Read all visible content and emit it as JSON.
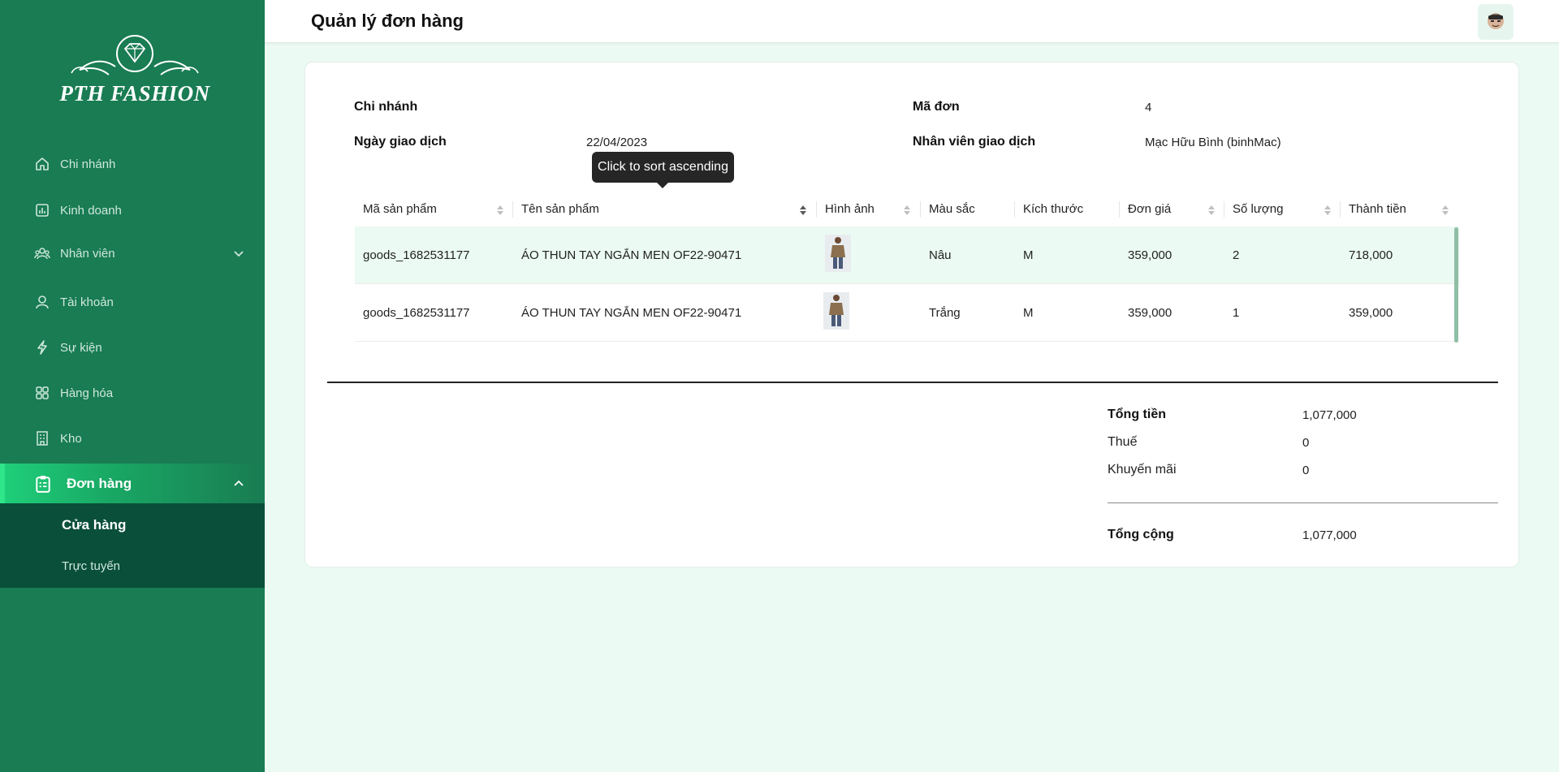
{
  "app": {
    "brand": "PTH FASHION"
  },
  "header": {
    "title": "Quản lý đơn hàng"
  },
  "sidebar": {
    "items": [
      {
        "label": "Chi nhánh",
        "icon": "home-icon"
      },
      {
        "label": "Kinh doanh",
        "icon": "chart-icon"
      },
      {
        "label": "Nhân viên",
        "icon": "users-icon"
      },
      {
        "label": "Tài khoản",
        "icon": "user-icon"
      },
      {
        "label": "Sự kiện",
        "icon": "bolt-icon"
      },
      {
        "label": "Hàng hóa",
        "icon": "grid-icon"
      },
      {
        "label": "Kho",
        "icon": "building-icon"
      },
      {
        "label": "Đơn hàng",
        "icon": "clipboard-icon"
      }
    ],
    "submenu": [
      {
        "label": "Cửa hàng"
      },
      {
        "label": "Trực tuyến"
      }
    ]
  },
  "order": {
    "branch_label": "Chi nhánh",
    "branch_value": "",
    "date_label": "Ngày giao dịch",
    "date_value": "22/04/2023",
    "code_label": "Mã đơn",
    "code_value": "4",
    "staff_label": "Nhân viên giao dịch",
    "staff_value": "Mạc Hữu Bình (binhMac)"
  },
  "table": {
    "columns": [
      "Mã sản phẩm",
      "Tên sản phẩm",
      "Hình ảnh",
      "Màu sắc",
      "Kích thước",
      "Đơn giá",
      "Số lượng",
      "Thành tiền"
    ],
    "rows": [
      {
        "code": "goods_1682531177",
        "name": "ÁO THUN TAY NGẮN MEN OF22-90471",
        "color": "Nâu",
        "size": "M",
        "price": "359,000",
        "qty": "2",
        "total": "718,000"
      },
      {
        "code": "goods_1682531177",
        "name": "ÁO THUN TAY NGẮN MEN OF22-90471",
        "color": "Trắng",
        "size": "M",
        "price": "359,000",
        "qty": "1",
        "total": "359,000"
      }
    ],
    "tooltip": "Click to sort ascending"
  },
  "summary": {
    "subtotal_label": "Tổng tiền",
    "subtotal_value": "1,077,000",
    "tax_label": "Thuế",
    "tax_value": "0",
    "discount_label": "Khuyến mãi",
    "discount_value": "0",
    "total_label": "Tổng cộng",
    "total_value": "1,077,000"
  },
  "colors": {
    "sidebar": "#197c52",
    "accent": "#1fd07a",
    "submenu": "#0a4f3a",
    "page_bg": "#ebfaf2"
  }
}
